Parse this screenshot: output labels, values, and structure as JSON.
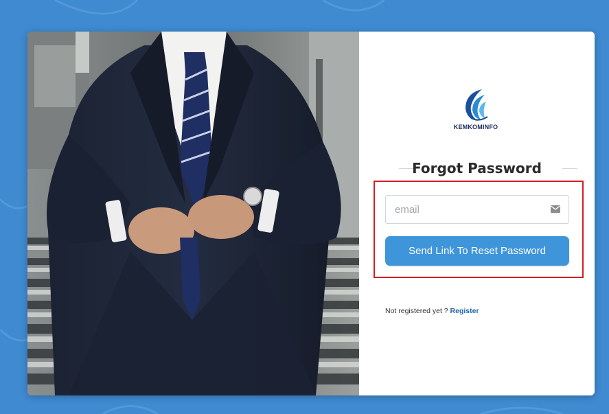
{
  "colors": {
    "background": "#3f8ad1",
    "accent": "#3f95d9",
    "highlight_border": "#d51d24",
    "link": "#1e66b4"
  },
  "logo": {
    "icon": "kemkominfo-logo",
    "text": "KEMKOMINFO"
  },
  "photo": {
    "icon": "businessman-photo"
  },
  "form": {
    "title": "Forgot Password",
    "email": {
      "placeholder": "email",
      "value": "",
      "icon": "envelope-icon"
    },
    "submit_label": "Send Link To Reset Password"
  },
  "footer": {
    "prompt": "Not registered yet ? ",
    "register_label": "Register"
  }
}
